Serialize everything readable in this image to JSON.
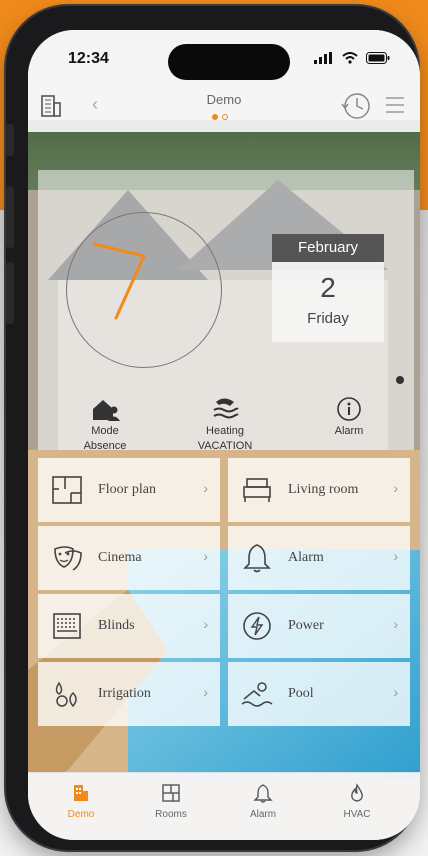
{
  "status_bar": {
    "time": "12:34"
  },
  "header": {
    "title": "Demo",
    "page_dots": 2,
    "active_dot": 0
  },
  "date": {
    "month": "February",
    "day": "2",
    "weekday": "Friday"
  },
  "status_items": [
    {
      "line1": "Mode",
      "line2": "Absence",
      "icon": "house-person-icon"
    },
    {
      "line1": "Heating",
      "line2": "VACATION",
      "icon": "heating-icon"
    },
    {
      "line1": "Alarm",
      "line2": "",
      "icon": "info-icon"
    }
  ],
  "tiles": [
    {
      "label": "Floor plan",
      "icon": "floor-plan-icon"
    },
    {
      "label": "Living room",
      "icon": "bed-icon"
    },
    {
      "label": "Cinema",
      "icon": "theater-masks-icon"
    },
    {
      "label": "Alarm",
      "icon": "bell-icon"
    },
    {
      "label": "Blinds",
      "icon": "blinds-icon"
    },
    {
      "label": "Power",
      "icon": "power-icon"
    },
    {
      "label": "Irrigation",
      "icon": "irrigation-icon"
    },
    {
      "label": "Pool",
      "icon": "pool-icon"
    }
  ],
  "nav": [
    {
      "label": "Demo",
      "icon": "building-icon"
    },
    {
      "label": "Rooms",
      "icon": "rooms-icon"
    },
    {
      "label": "Alarm",
      "icon": "bell-icon"
    },
    {
      "label": "HVAC",
      "icon": "flame-icon"
    }
  ],
  "colors": {
    "accent": "#f08a1c",
    "clock_hand": "#f08a1c",
    "month_bar": "#555555"
  }
}
